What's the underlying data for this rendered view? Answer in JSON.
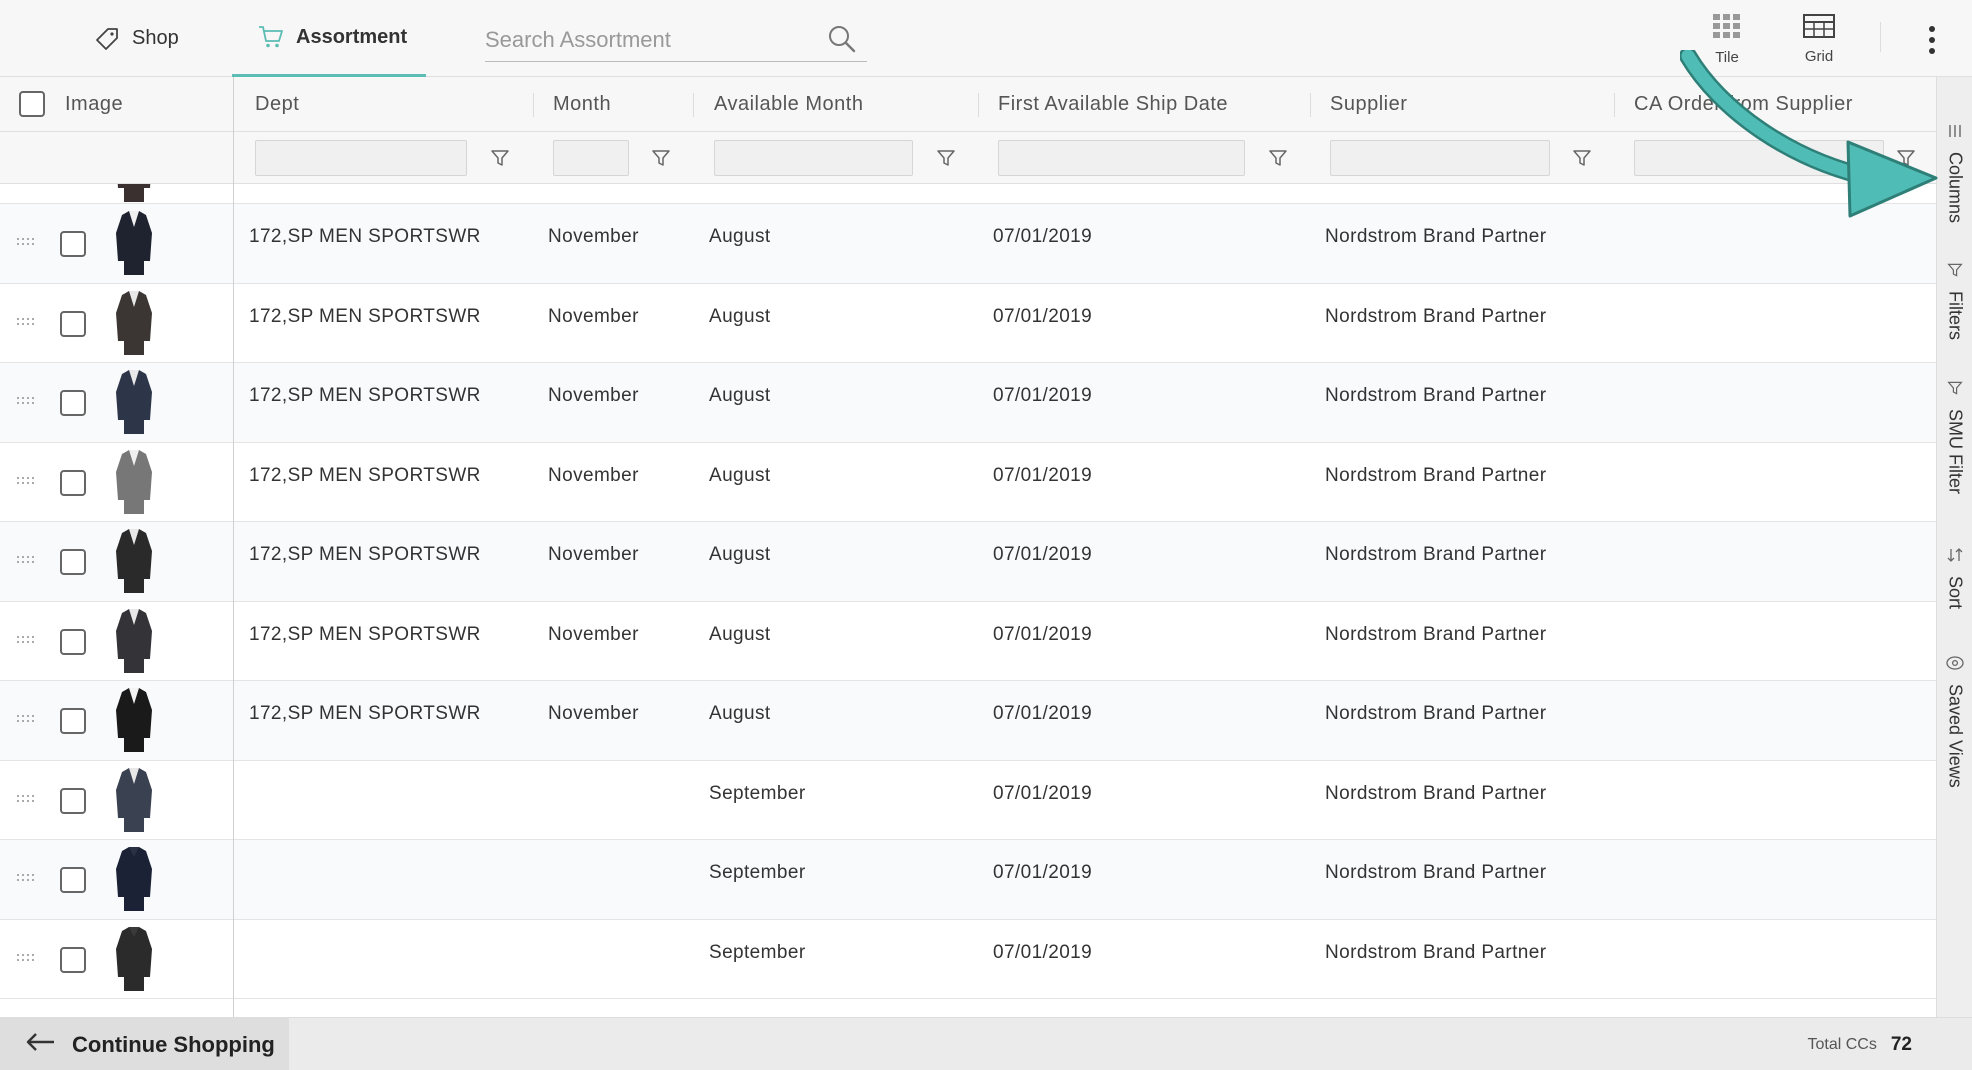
{
  "topbar": {
    "tabs": [
      {
        "label": "Shop",
        "icon": "tag-icon"
      },
      {
        "label": "Assortment",
        "icon": "cart-icon",
        "active": true
      }
    ],
    "search": {
      "placeholder": "Search Assortment",
      "value": ""
    },
    "view_buttons": [
      {
        "label": "Tile",
        "icon": "tile-icon"
      },
      {
        "label": "Grid",
        "icon": "grid-icon"
      }
    ]
  },
  "columns": {
    "image": "Image",
    "dept": "Dept",
    "month": "Month",
    "available_month": "Available Month",
    "first_ship": "First Available Ship Date",
    "supplier": "Supplier",
    "ca_order": "CA Order from Supplier"
  },
  "rows": [
    {
      "dept": "",
      "month": "",
      "available_month": "",
      "first_ship": "",
      "supplier": ""
    },
    {
      "dept": "172,SP MEN SPORTSWR",
      "month": "November",
      "available_month": "August",
      "first_ship": "07/01/2019",
      "supplier": "Nordstrom Brand Partner"
    },
    {
      "dept": "172,SP MEN SPORTSWR",
      "month": "November",
      "available_month": "August",
      "first_ship": "07/01/2019",
      "supplier": "Nordstrom Brand Partner"
    },
    {
      "dept": "172,SP MEN SPORTSWR",
      "month": "November",
      "available_month": "August",
      "first_ship": "07/01/2019",
      "supplier": "Nordstrom Brand Partner"
    },
    {
      "dept": "172,SP MEN SPORTSWR",
      "month": "November",
      "available_month": "August",
      "first_ship": "07/01/2019",
      "supplier": "Nordstrom Brand Partner"
    },
    {
      "dept": "172,SP MEN SPORTSWR",
      "month": "November",
      "available_month": "August",
      "first_ship": "07/01/2019",
      "supplier": "Nordstrom Brand Partner"
    },
    {
      "dept": "172,SP MEN SPORTSWR",
      "month": "November",
      "available_month": "August",
      "first_ship": "07/01/2019",
      "supplier": "Nordstrom Brand Partner"
    },
    {
      "dept": "172,SP MEN SPORTSWR",
      "month": "November",
      "available_month": "August",
      "first_ship": "07/01/2019",
      "supplier": "Nordstrom Brand Partner"
    },
    {
      "dept": "",
      "month": "",
      "available_month": "September",
      "first_ship": "07/01/2019",
      "supplier": "Nordstrom Brand Partner"
    },
    {
      "dept": "",
      "month": "",
      "available_month": "September",
      "first_ship": "07/01/2019",
      "supplier": "Nordstrom Brand Partner"
    },
    {
      "dept": "",
      "month": "",
      "available_month": "September",
      "first_ship": "07/01/2019",
      "supplier": "Nordstrom Brand Partner"
    }
  ],
  "side_panel": [
    {
      "label": "Columns",
      "icon": "columns-icon"
    },
    {
      "label": "Filters",
      "icon": "filter-icon"
    },
    {
      "label": "SMU Filter",
      "icon": "filter-icon"
    },
    {
      "label": "Sort",
      "icon": "sort-icon"
    },
    {
      "label": "Saved Views",
      "icon": "eye-icon"
    }
  ],
  "bottombar": {
    "continue_label": "Continue Shopping",
    "total_label": "Total CCs",
    "total_value": "72"
  },
  "colors": {
    "accent": "#5bbdb4",
    "annotation_arrow": "#4fbdb5"
  }
}
